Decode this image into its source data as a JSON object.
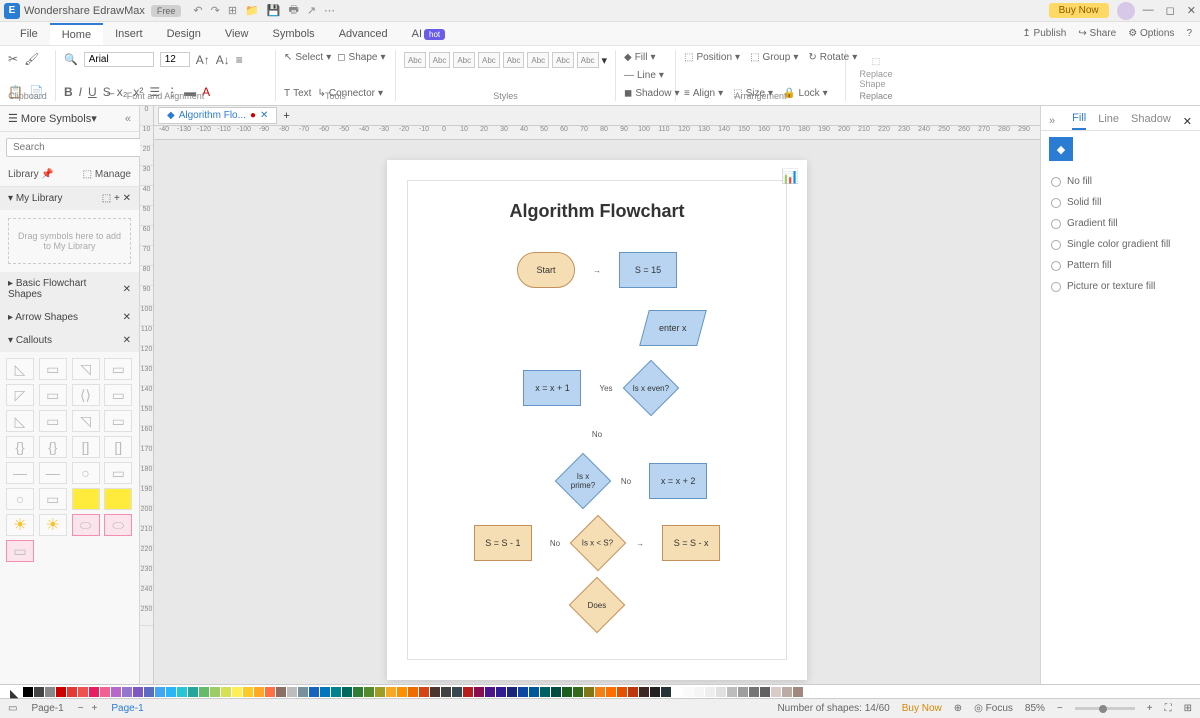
{
  "app": {
    "name": "Wondershare EdrawMax",
    "badge": "Free"
  },
  "titlebar": {
    "buy": "Buy Now"
  },
  "menu": {
    "file": "File",
    "home": "Home",
    "insert": "Insert",
    "design": "Design",
    "view": "View",
    "symbols": "Symbols",
    "advanced": "Advanced",
    "ai": "AI",
    "ai_badge": "hot",
    "publish": "Publish",
    "share": "Share",
    "options": "Options"
  },
  "ribbon": {
    "clipboard": "Clipboard",
    "font_align": "Font and Alignment",
    "tools": "Tools",
    "styles": "Styles",
    "arrangement": "Arrangement",
    "replace": "Replace",
    "font": "Arial",
    "size": "12",
    "select": "Select",
    "shape": "Shape",
    "text": "Text",
    "connector": "Connector",
    "abc": "Abc",
    "fill": "Fill",
    "line": "Line",
    "shadow": "Shadow",
    "position": "Position",
    "align": "Align",
    "group": "Group",
    "size_btn": "Size",
    "rotate": "Rotate",
    "lock": "Lock",
    "replace_shape": "Replace Shape"
  },
  "sidebar": {
    "more_symbols": "More Symbols",
    "search_placeholder": "Search",
    "search_btn": "Search",
    "library": "Library",
    "manage": "Manage",
    "my_library": "My Library",
    "drag_hint": "Drag symbols here to add to My Library",
    "basic_shapes": "Basic Flowchart Shapes",
    "arrow_shapes": "Arrow Shapes",
    "callouts": "Callouts"
  },
  "doc": {
    "tab": "Algorithm Flo...",
    "title": "Algorithm Flowchart"
  },
  "chart_data": {
    "type": "flowchart",
    "nodes": [
      {
        "id": "start",
        "shape": "terminator",
        "label": "Start",
        "fill": "#f5deb3"
      },
      {
        "id": "s15",
        "shape": "process",
        "label": "S = 15",
        "fill": "#b8d4f0"
      },
      {
        "id": "enterx",
        "shape": "data",
        "label": "enter x",
        "fill": "#b8d4f0"
      },
      {
        "id": "xeven",
        "shape": "decision",
        "label": "Is x even?",
        "fill": "#b8d4f0"
      },
      {
        "id": "xp1",
        "shape": "process",
        "label": "x = x + 1",
        "fill": "#b8d4f0"
      },
      {
        "id": "xprime",
        "shape": "decision",
        "label": "Is x prime?",
        "fill": "#b8d4f0"
      },
      {
        "id": "xp2",
        "shape": "process",
        "label": "x = x + 2",
        "fill": "#b8d4f0"
      },
      {
        "id": "xlts",
        "shape": "decision",
        "label": "Is x < S?",
        "fill": "#f5deb3"
      },
      {
        "id": "sm1",
        "shape": "process",
        "label": "S = S - 1",
        "fill": "#f5deb3"
      },
      {
        "id": "smx",
        "shape": "process",
        "label": "S = S - x",
        "fill": "#f5deb3"
      },
      {
        "id": "does",
        "shape": "decision",
        "label": "Does",
        "fill": "#f5deb3"
      }
    ],
    "edges": [
      {
        "from": "start",
        "to": "s15"
      },
      {
        "from": "s15",
        "to": "enterx"
      },
      {
        "from": "enterx",
        "to": "xeven"
      },
      {
        "from": "xeven",
        "to": "xp1",
        "label": "Yes"
      },
      {
        "from": "xeven",
        "to": "xprime",
        "label": "No"
      },
      {
        "from": "xprime",
        "to": "xp2",
        "label": "No"
      },
      {
        "from": "xprime",
        "to": "xlts"
      },
      {
        "from": "xlts",
        "to": "sm1",
        "label": "No"
      },
      {
        "from": "xlts",
        "to": "smx"
      },
      {
        "from": "sm1",
        "to": "does"
      }
    ],
    "labels": {
      "yes": "Yes",
      "no": "No"
    }
  },
  "right": {
    "fill": "Fill",
    "line": "Line",
    "shadow": "Shadow",
    "no_fill": "No fill",
    "solid": "Solid fill",
    "gradient": "Gradient fill",
    "single_gradient": "Single color gradient fill",
    "pattern": "Pattern fill",
    "picture": "Picture or texture fill"
  },
  "ruler_h": [
    "-40",
    "-130",
    "-120",
    "-110",
    "-100",
    "-90",
    "-80",
    "-70",
    "-60",
    "-50",
    "-40",
    "-30",
    "-20",
    "-10",
    "0",
    "10",
    "20",
    "30",
    "40",
    "50",
    "60",
    "70",
    "80",
    "90",
    "100",
    "110",
    "120",
    "130",
    "140",
    "150",
    "160",
    "170",
    "180",
    "190",
    "200",
    "210",
    "220",
    "230",
    "240",
    "250",
    "260",
    "270",
    "280",
    "290"
  ],
  "ruler_v": [
    "0",
    "10",
    "20",
    "30",
    "40",
    "50",
    "60",
    "70",
    "80",
    "90",
    "100",
    "110",
    "120",
    "130",
    "140",
    "150",
    "160",
    "170",
    "180",
    "190",
    "200",
    "210",
    "220",
    "230",
    "240",
    "250"
  ],
  "colors": [
    "#000",
    "#444",
    "#888",
    "#c00",
    "#e53935",
    "#ef5350",
    "#e91e63",
    "#f06292",
    "#ba68c8",
    "#9575cd",
    "#7e57c2",
    "#5c6bc0",
    "#42a5f5",
    "#29b6f6",
    "#26c6da",
    "#26a69a",
    "#66bb6a",
    "#9ccc65",
    "#d4e157",
    "#ffee58",
    "#ffca28",
    "#ffa726",
    "#ff7043",
    "#8d6e63",
    "#bdbdbd",
    "#78909c",
    "#1565c0",
    "#0277bd",
    "#00838f",
    "#00695c",
    "#2e7d32",
    "#558b2f",
    "#9e9d24",
    "#f9a825",
    "#ff8f00",
    "#ef6c00",
    "#d84315",
    "#4e342e",
    "#424242",
    "#37474f",
    "#b71c1c",
    "#880e4f",
    "#4a148c",
    "#311b92",
    "#1a237e",
    "#0d47a1",
    "#01579b",
    "#006064",
    "#004d40",
    "#1b5e20",
    "#33691e",
    "#827717",
    "#f57f17",
    "#ff6f00",
    "#e65100",
    "#bf360c",
    "#3e2723",
    "#212121",
    "#263238",
    "#fff",
    "#fafafa",
    "#f5f5f5",
    "#eee",
    "#e0e0e0",
    "#bdbdbd",
    "#9e9e9e",
    "#757575",
    "#616161",
    "#d7ccc8",
    "#bcaaa4",
    "#a1887f"
  ],
  "status": {
    "page1": "Page-1",
    "page_label": "Page-1",
    "shapes": "Number of shapes: 14/60",
    "buy": "Buy Now",
    "focus": "Focus",
    "zoom": "85%"
  }
}
